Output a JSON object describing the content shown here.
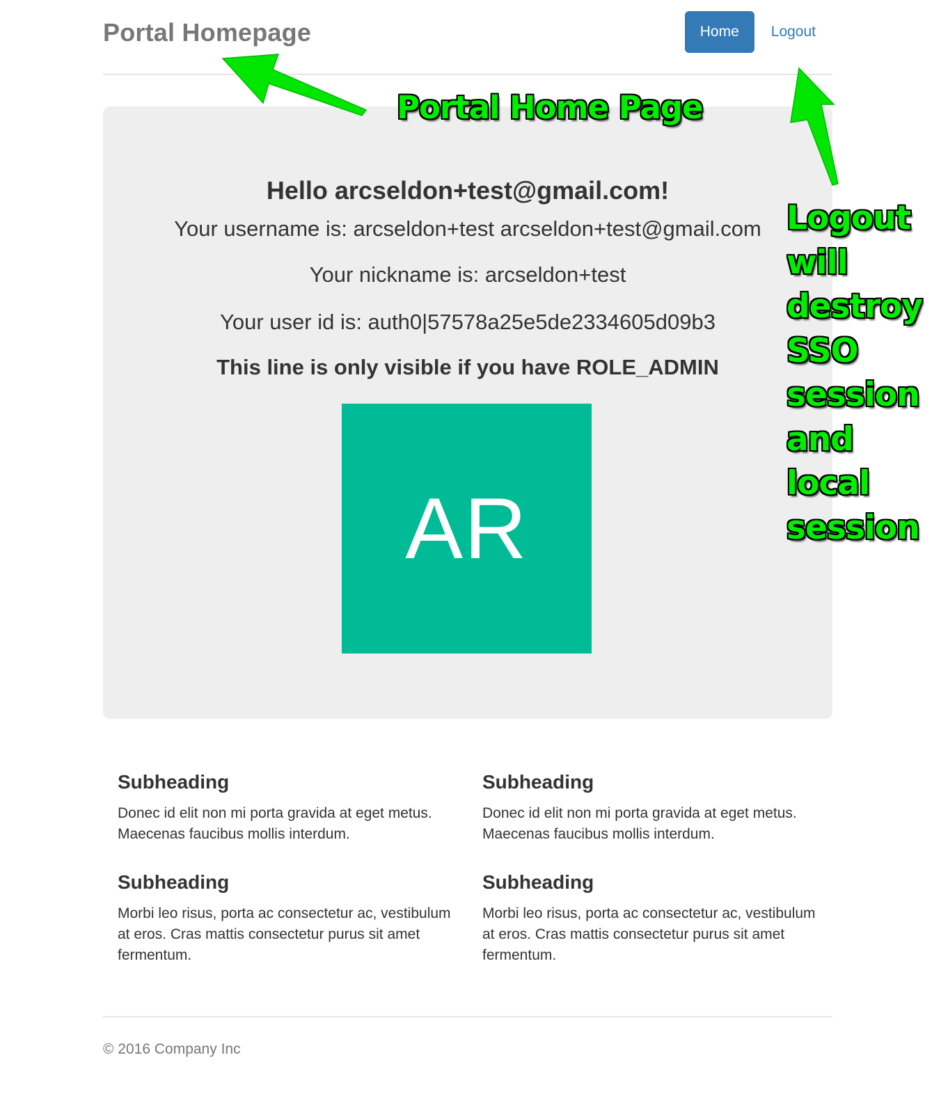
{
  "header": {
    "brand": "Portal Homepage",
    "nav": {
      "home_label": "Home",
      "logout_label": "Logout"
    }
  },
  "jumbotron": {
    "greeting": "Hello arcseldon+test@gmail.com!",
    "username_line": "Your username is: arcseldon+test arcseldon+test@gmail.com",
    "nickname_line": "Your nickname is: arcseldon+test",
    "user_id_line": "Your user id is: auth0|57578a25e5de2334605d09b3",
    "admin_line": "This line is only visible if you have ROLE_ADMIN",
    "avatar_initials": "AR",
    "avatar_color": "#00bb96"
  },
  "sections": [
    {
      "heading": "Subheading",
      "text": "Donec id elit non mi porta gravida at eget metus. Maecenas faucibus mollis interdum."
    },
    {
      "heading": "Subheading",
      "text": "Donec id elit non mi porta gravida at eget metus. Maecenas faucibus mollis interdum."
    },
    {
      "heading": "Subheading",
      "text": "Morbi leo risus, porta ac consectetur ac, vestibulum at eros. Cras mattis consectetur purus sit amet fermentum."
    },
    {
      "heading": "Subheading",
      "text": "Morbi leo risus, porta ac consectetur ac, vestibulum at eros. Cras mattis consectetur purus sit amet fermentum."
    }
  ],
  "footer": {
    "copyright": "© 2016 Company Inc"
  },
  "annotations": {
    "home_page": "Portal Home Page",
    "logout_note": "Logout\nwill\ndestroy\nSSO\nsession\nand\nlocal\nsession",
    "annotation_color": "#00ee00"
  },
  "colors": {
    "primary": "#337ab7",
    "jumbotron_bg": "#eeeeee",
    "brand_text": "#777777"
  }
}
